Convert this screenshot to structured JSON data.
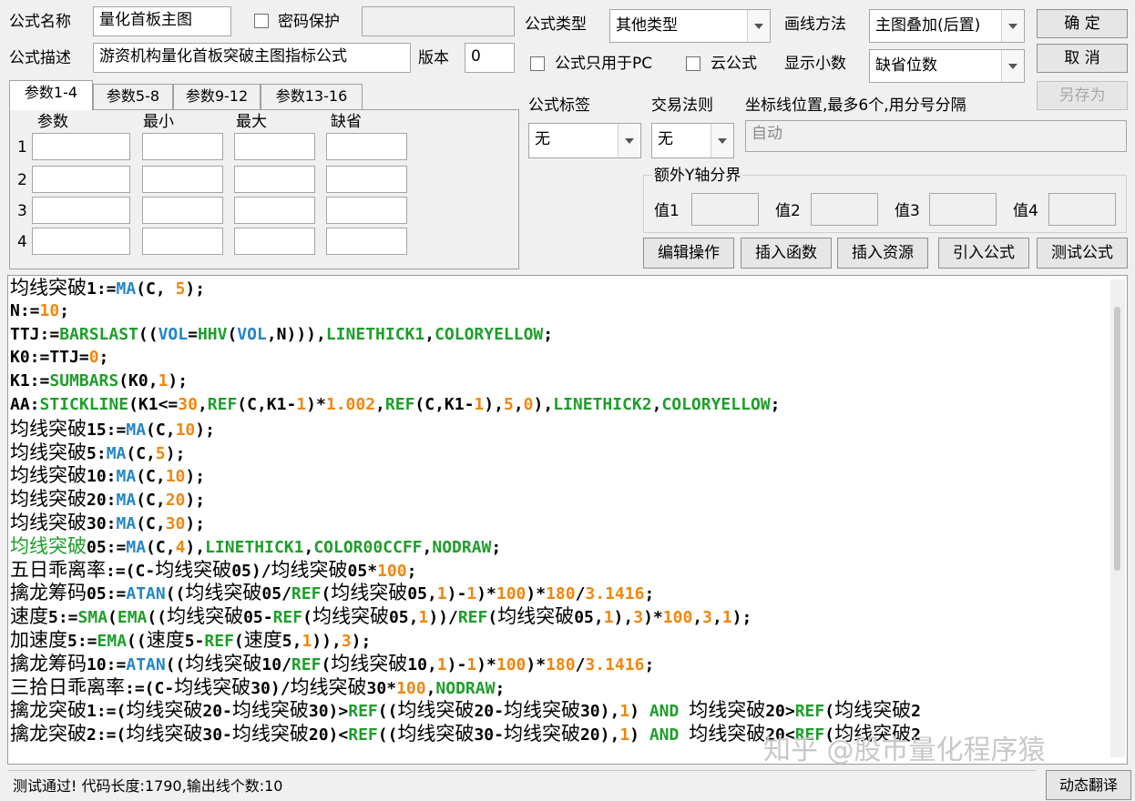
{
  "header": {
    "formula_name_label": "公式名称",
    "formula_name_value": "量化首板主图",
    "password_label": "密码保护",
    "formula_desc_label": "公式描述",
    "formula_desc_value": "游资机构量化首板突破主图指标公式",
    "version_label": "版本",
    "version_value": "0",
    "formula_type_label": "公式类型",
    "formula_type_value": "其他类型",
    "draw_method_label": "画线方法",
    "draw_method_value": "主图叠加(后置)",
    "pc_only_label": "公式只用于PC",
    "cloud_label": "云公式",
    "decimals_label": "显示小数",
    "decimals_value": "缺省位数"
  },
  "buttons": {
    "ok": "确 定",
    "cancel": "取 消",
    "save_as": "另存为",
    "edit_ops": "编辑操作",
    "insert_func": "插入函数",
    "insert_res": "插入资源",
    "import_formula": "引入公式",
    "test_formula": "测试公式",
    "dynamic_translate": "动态翻译"
  },
  "tabs": [
    {
      "label": "参数1-4"
    },
    {
      "label": "参数5-8"
    },
    {
      "label": "参数9-12"
    },
    {
      "label": "参数13-16"
    }
  ],
  "params": {
    "col_param": "参数",
    "col_min": "最小",
    "col_max": "最大",
    "col_default": "缺省",
    "rows": [
      "1",
      "2",
      "3",
      "4"
    ]
  },
  "right_panel": {
    "tag_label": "公式标签",
    "tag_value": "无",
    "trade_rule_label": "交易法则",
    "trade_rule_value": "无",
    "coord_label": "坐标线位置,最多6个,用分号分隔",
    "coord_value": "自动",
    "extra_y_label": "额外Y轴分界",
    "v1": "值1",
    "v2": "值2",
    "v3": "值3",
    "v4": "值4"
  },
  "code_lines": [
    [
      [
        "c-cn cn",
        "均线突破"
      ],
      [
        "c-k",
        "1:="
      ],
      [
        "c-f",
        "MA"
      ],
      [
        "c-k",
        "(C, "
      ],
      [
        "c-n",
        "5"
      ],
      [
        "c-k",
        ");"
      ]
    ],
    [
      [
        "c-k",
        "N:="
      ],
      [
        "c-n",
        "10"
      ],
      [
        "c-k",
        ";"
      ]
    ],
    [
      [
        "c-k",
        "TTJ:="
      ],
      [
        "c-g",
        "BARSLAST"
      ],
      [
        "c-k",
        "(("
      ],
      [
        "c-f",
        "VOL"
      ],
      [
        "c-k",
        "="
      ],
      [
        "c-g",
        "HHV"
      ],
      [
        "c-k",
        "("
      ],
      [
        "c-f",
        "VOL"
      ],
      [
        "c-k",
        ",N))),"
      ],
      [
        "c-g",
        "LINETHICK1"
      ],
      [
        "c-k",
        ","
      ],
      [
        "c-g",
        "COLORYELLOW"
      ],
      [
        "c-k",
        ";"
      ]
    ],
    [
      [
        "c-k",
        "K0:=TTJ="
      ],
      [
        "c-n",
        "0"
      ],
      [
        "c-k",
        ";"
      ]
    ],
    [
      [
        "c-k",
        "K1:="
      ],
      [
        "c-g",
        "SUMBARS"
      ],
      [
        "c-k",
        "(K0,"
      ],
      [
        "c-n",
        "1"
      ],
      [
        "c-k",
        ");"
      ]
    ],
    [
      [
        "c-k",
        "AA:"
      ],
      [
        "c-g",
        "STICKLINE"
      ],
      [
        "c-k",
        "(K1<="
      ],
      [
        "c-n",
        "30"
      ],
      [
        "c-k",
        ","
      ],
      [
        "c-g",
        "REF"
      ],
      [
        "c-k",
        "(C,K1-"
      ],
      [
        "c-n",
        "1"
      ],
      [
        "c-k",
        ")*"
      ],
      [
        "c-n",
        "1.002"
      ],
      [
        "c-k",
        ","
      ],
      [
        "c-g",
        "REF"
      ],
      [
        "c-k",
        "(C,K1-"
      ],
      [
        "c-n",
        "1"
      ],
      [
        "c-k",
        "),"
      ],
      [
        "c-n",
        "5"
      ],
      [
        "c-k",
        ","
      ],
      [
        "c-n",
        "0"
      ],
      [
        "c-k",
        "),"
      ],
      [
        "c-g",
        "LINETHICK2"
      ],
      [
        "c-k",
        ","
      ],
      [
        "c-g",
        "COLORYELLOW"
      ],
      [
        "c-k",
        ";"
      ]
    ],
    [
      [
        "c-cn cn",
        "均线突破"
      ],
      [
        "c-k",
        "15:="
      ],
      [
        "c-f",
        "MA"
      ],
      [
        "c-k",
        "(C,"
      ],
      [
        "c-n",
        "10"
      ],
      [
        "c-k",
        ");"
      ]
    ],
    [
      [
        "c-cn cn",
        "均线突破"
      ],
      [
        "c-k",
        "5:"
      ],
      [
        "c-f",
        "MA"
      ],
      [
        "c-k",
        "(C,"
      ],
      [
        "c-n",
        "5"
      ],
      [
        "c-k",
        ");"
      ]
    ],
    [
      [
        "c-cn cn",
        "均线突破"
      ],
      [
        "c-k",
        "10:"
      ],
      [
        "c-f",
        "MA"
      ],
      [
        "c-k",
        "(C,"
      ],
      [
        "c-n",
        "10"
      ],
      [
        "c-k",
        ");"
      ]
    ],
    [
      [
        "c-cn cn",
        "均线突破"
      ],
      [
        "c-k",
        "20:"
      ],
      [
        "c-f",
        "MA"
      ],
      [
        "c-k",
        "(C,"
      ],
      [
        "c-n",
        "20"
      ],
      [
        "c-k",
        ");"
      ]
    ],
    [
      [
        "c-cn cn",
        "均线突破"
      ],
      [
        "c-k",
        "30:"
      ],
      [
        "c-f",
        "MA"
      ],
      [
        "c-k",
        "(C,"
      ],
      [
        "c-n",
        "30"
      ],
      [
        "c-k",
        ");"
      ]
    ],
    [
      [
        "c-gc cn",
        "均线突破"
      ],
      [
        "c-k",
        "05:="
      ],
      [
        "c-f",
        "MA"
      ],
      [
        "c-k",
        "(C,"
      ],
      [
        "c-n",
        "4"
      ],
      [
        "c-k",
        "),"
      ],
      [
        "c-g",
        "LINETHICK1"
      ],
      [
        "c-k",
        ","
      ],
      [
        "c-g",
        "COLOR00CCFF"
      ],
      [
        "c-k",
        ","
      ],
      [
        "c-g",
        "NODRAW"
      ],
      [
        "c-k",
        ";"
      ]
    ],
    [
      [
        "c-cn cn",
        "五日乖离率"
      ],
      [
        "c-k",
        ":=(C-"
      ],
      [
        "c-cn cn",
        "均线突破"
      ],
      [
        "c-k",
        "05)/"
      ],
      [
        "c-cn cn",
        "均线突破"
      ],
      [
        "c-k",
        "05*"
      ],
      [
        "c-n",
        "100"
      ],
      [
        "c-k",
        ";"
      ]
    ],
    [
      [
        "c-cn cn",
        "擒龙筹码"
      ],
      [
        "c-k",
        "05:="
      ],
      [
        "c-f",
        "ATAN"
      ],
      [
        "c-k",
        "(("
      ],
      [
        "c-cn cn",
        "均线突破"
      ],
      [
        "c-k",
        "05/"
      ],
      [
        "c-g",
        "REF"
      ],
      [
        "c-k",
        "("
      ],
      [
        "c-cn cn",
        "均线突破"
      ],
      [
        "c-k",
        "05,"
      ],
      [
        "c-n",
        "1"
      ],
      [
        "c-k",
        ")-"
      ],
      [
        "c-n",
        "1"
      ],
      [
        "c-k",
        ")*"
      ],
      [
        "c-n",
        "100"
      ],
      [
        "c-k",
        ")*"
      ],
      [
        "c-n",
        "180"
      ],
      [
        "c-k",
        "/"
      ],
      [
        "c-n",
        "3.1416"
      ],
      [
        "c-k",
        ";"
      ]
    ],
    [
      [
        "c-cn cn",
        "速度"
      ],
      [
        "c-k",
        "5:="
      ],
      [
        "c-g",
        "SMA"
      ],
      [
        "c-k",
        "("
      ],
      [
        "c-g",
        "EMA"
      ],
      [
        "c-k",
        "(("
      ],
      [
        "c-cn cn",
        "均线突破"
      ],
      [
        "c-k",
        "05-"
      ],
      [
        "c-g",
        "REF"
      ],
      [
        "c-k",
        "("
      ],
      [
        "c-cn cn",
        "均线突破"
      ],
      [
        "c-k",
        "05,"
      ],
      [
        "c-n",
        "1"
      ],
      [
        "c-k",
        "))/"
      ],
      [
        "c-g",
        "REF"
      ],
      [
        "c-k",
        "("
      ],
      [
        "c-cn cn",
        "均线突破"
      ],
      [
        "c-k",
        "05,"
      ],
      [
        "c-n",
        "1"
      ],
      [
        "c-k",
        "),"
      ],
      [
        "c-n",
        "3"
      ],
      [
        "c-k",
        ")*"
      ],
      [
        "c-n",
        "100"
      ],
      [
        "c-k",
        ","
      ],
      [
        "c-n",
        "3"
      ],
      [
        "c-k",
        ","
      ],
      [
        "c-n",
        "1"
      ],
      [
        "c-k",
        ");"
      ]
    ],
    [
      [
        "c-cn cn",
        "加速度"
      ],
      [
        "c-k",
        "5:="
      ],
      [
        "c-g",
        "EMA"
      ],
      [
        "c-k",
        "(("
      ],
      [
        "c-cn cn",
        "速度"
      ],
      [
        "c-k",
        "5-"
      ],
      [
        "c-g",
        "REF"
      ],
      [
        "c-k",
        "("
      ],
      [
        "c-cn cn",
        "速度"
      ],
      [
        "c-k",
        "5,"
      ],
      [
        "c-n",
        "1"
      ],
      [
        "c-k",
        ")),"
      ],
      [
        "c-n",
        "3"
      ],
      [
        "c-k",
        ");"
      ]
    ],
    [
      [
        "c-cn cn",
        "擒龙筹码"
      ],
      [
        "c-k",
        "10:="
      ],
      [
        "c-f",
        "ATAN"
      ],
      [
        "c-k",
        "(("
      ],
      [
        "c-cn cn",
        "均线突破"
      ],
      [
        "c-k",
        "10/"
      ],
      [
        "c-g",
        "REF"
      ],
      [
        "c-k",
        "("
      ],
      [
        "c-cn cn",
        "均线突破"
      ],
      [
        "c-k",
        "10,"
      ],
      [
        "c-n",
        "1"
      ],
      [
        "c-k",
        ")-"
      ],
      [
        "c-n",
        "1"
      ],
      [
        "c-k",
        ")*"
      ],
      [
        "c-n",
        "100"
      ],
      [
        "c-k",
        ")*"
      ],
      [
        "c-n",
        "180"
      ],
      [
        "c-k",
        "/"
      ],
      [
        "c-n",
        "3.1416"
      ],
      [
        "c-k",
        ";"
      ]
    ],
    [
      [
        "c-cn cn",
        "三拾日乖离率"
      ],
      [
        "c-k",
        ":=(C-"
      ],
      [
        "c-cn cn",
        "均线突破"
      ],
      [
        "c-k",
        "30)/"
      ],
      [
        "c-cn cn",
        "均线突破"
      ],
      [
        "c-k",
        "30*"
      ],
      [
        "c-n",
        "100"
      ],
      [
        "c-k",
        ","
      ],
      [
        "c-g",
        "NODRAW"
      ],
      [
        "c-k",
        ";"
      ]
    ],
    [
      [
        "c-cn cn",
        "擒龙突破"
      ],
      [
        "c-k",
        "1:=("
      ],
      [
        "c-cn cn",
        "均线突破"
      ],
      [
        "c-k",
        "20-"
      ],
      [
        "c-cn cn",
        "均线突破"
      ],
      [
        "c-k",
        "30)>"
      ],
      [
        "c-g",
        "REF"
      ],
      [
        "c-k",
        "(("
      ],
      [
        "c-cn cn",
        "均线突破"
      ],
      [
        "c-k",
        "20-"
      ],
      [
        "c-cn cn",
        "均线突破"
      ],
      [
        "c-k",
        "30),"
      ],
      [
        "c-n",
        "1"
      ],
      [
        "c-k",
        ") "
      ],
      [
        "c-g",
        "AND"
      ],
      [
        "c-k",
        " "
      ],
      [
        "c-cn cn",
        "均线突破"
      ],
      [
        "c-k",
        "20>"
      ],
      [
        "c-g",
        "REF"
      ],
      [
        "c-k",
        "("
      ],
      [
        "c-cn cn",
        "均线突破"
      ],
      [
        "c-k",
        "2"
      ]
    ],
    [
      [
        "c-cn cn",
        "擒龙突破"
      ],
      [
        "c-k",
        "2:=("
      ],
      [
        "c-cn cn",
        "均线突破"
      ],
      [
        "c-k",
        "30-"
      ],
      [
        "c-cn cn",
        "均线突破"
      ],
      [
        "c-k",
        "20)<"
      ],
      [
        "c-g",
        "REF"
      ],
      [
        "c-k",
        "(("
      ],
      [
        "c-cn cn",
        "均线突破"
      ],
      [
        "c-k",
        "30-"
      ],
      [
        "c-cn cn",
        "均线突破"
      ],
      [
        "c-k",
        "20),"
      ],
      [
        "c-n",
        "1"
      ],
      [
        "c-k",
        ") "
      ],
      [
        "c-g",
        "AND"
      ],
      [
        "c-k",
        " "
      ],
      [
        "c-cn cn",
        "均线突破"
      ],
      [
        "c-k",
        "20<"
      ],
      [
        "c-g",
        "REF"
      ],
      [
        "c-k",
        "("
      ],
      [
        "c-cn cn",
        "均线突破"
      ],
      [
        "c-k",
        "2"
      ]
    ]
  ],
  "status": {
    "text": "测试通过! 代码长度:1790,输出线个数:10"
  },
  "watermark": "知乎 @股市量化程序猿"
}
